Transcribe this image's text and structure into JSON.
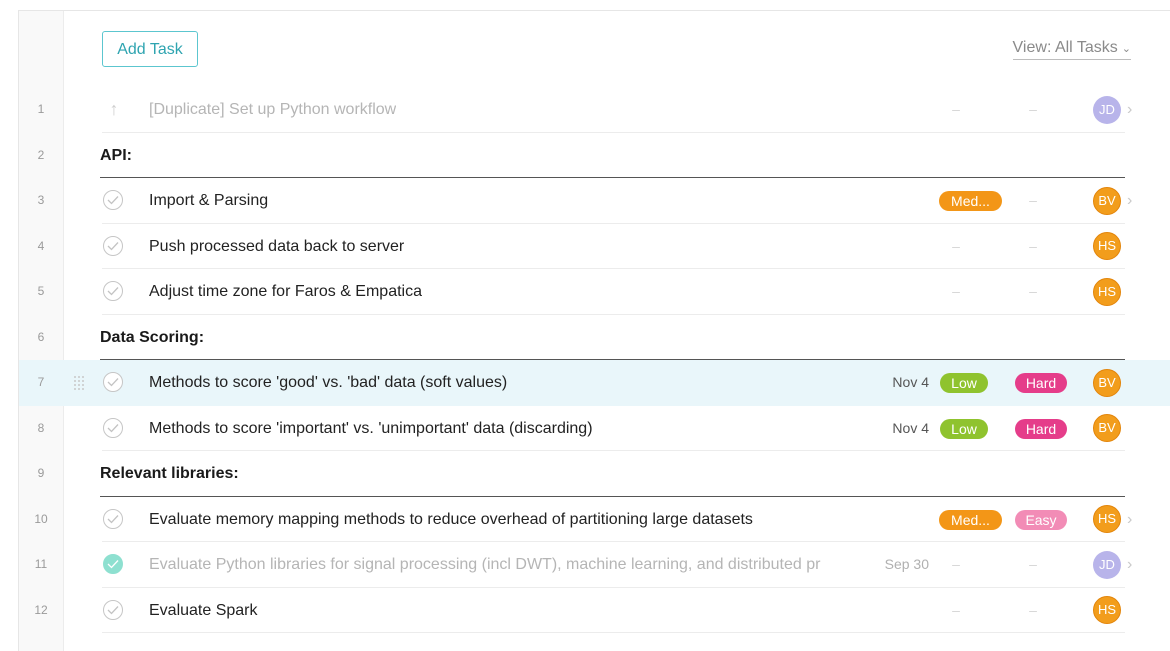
{
  "toolbar": {
    "add_task_label": "Add Task",
    "view_label": "View: All Tasks",
    "view_chevron": "⌄"
  },
  "rows": [
    {
      "num": "1",
      "type": "task",
      "title": "[Duplicate] Set up Python workflow",
      "state": "duplicate",
      "date": "",
      "priority": "",
      "difficulty": "",
      "assignee": "JD",
      "assignee_color": "#b8b4ea",
      "expand": true
    },
    {
      "num": "2",
      "type": "section",
      "title": "API:"
    },
    {
      "num": "3",
      "type": "task",
      "title": "Import & Parsing",
      "state": "open",
      "date": "",
      "priority": "Med...",
      "difficulty": "",
      "assignee": "BV",
      "assignee_color": "#f29d1c",
      "expand": true
    },
    {
      "num": "4",
      "type": "task",
      "title": "Push processed data back to server",
      "state": "open",
      "date": "",
      "priority": "",
      "difficulty": "",
      "assignee": "HS",
      "assignee_color": "#f29d1c",
      "expand": false
    },
    {
      "num": "5",
      "type": "task",
      "title": "Adjust time zone for Faros & Empatica",
      "state": "open",
      "date": "",
      "priority": "",
      "difficulty": "",
      "assignee": "HS",
      "assignee_color": "#f29d1c",
      "expand": false
    },
    {
      "num": "6",
      "type": "section",
      "title": "Data Scoring:"
    },
    {
      "num": "7",
      "type": "task",
      "title": "Methods to score 'good' vs. 'bad' data (soft values)",
      "state": "open",
      "highlight": true,
      "date": "Nov 4",
      "priority": "Low",
      "difficulty": "Hard",
      "assignee": "BV",
      "assignee_color": "#f29d1c",
      "expand": false
    },
    {
      "num": "8",
      "type": "task",
      "title": "Methods to score 'important' vs. 'unimportant' data (discarding)",
      "state": "open",
      "date": "Nov 4",
      "priority": "Low",
      "difficulty": "Hard",
      "assignee": "BV",
      "assignee_color": "#f29d1c",
      "expand": false
    },
    {
      "num": "9",
      "type": "section",
      "title": "Relevant libraries:"
    },
    {
      "num": "10",
      "type": "task",
      "title": "Evaluate memory mapping methods to reduce overhead of partitioning large datasets",
      "state": "open",
      "date": "",
      "priority": "Med...",
      "difficulty": "Easy",
      "assignee": "HS",
      "assignee_color": "#f29d1c",
      "expand": true
    },
    {
      "num": "11",
      "type": "task",
      "title": "Evaluate Python libraries for signal processing (incl DWT), machine learning, and distributed pr",
      "state": "done",
      "date": "Sep 30",
      "priority": "",
      "difficulty": "",
      "assignee": "JD",
      "assignee_color": "#b8b4ea",
      "expand": true
    },
    {
      "num": "12",
      "type": "task",
      "title": "Evaluate Spark",
      "state": "open",
      "date": "",
      "priority": "",
      "difficulty": "",
      "assignee": "HS",
      "assignee_color": "#f29d1c",
      "expand": false
    }
  ],
  "colors": {
    "accent": "#2ea4b0",
    "priority_med": "#f39617",
    "priority_low": "#8fc32e",
    "difficulty_hard": "#e53d8a",
    "difficulty_easy": "#f28cb6",
    "avatar_orange": "#f29d1c",
    "avatar_purple": "#b8b4ea",
    "highlight_row": "#e9f6fa"
  },
  "placeholders": {
    "empty_field": "–",
    "expand_glyph": "›"
  },
  "icons": {
    "check": "check-circle-icon",
    "duplicate": "up-arrow-icon",
    "drag": "drag-handle-icon",
    "expand": "chevron-right-icon",
    "view_dropdown": "chevron-down-icon"
  }
}
